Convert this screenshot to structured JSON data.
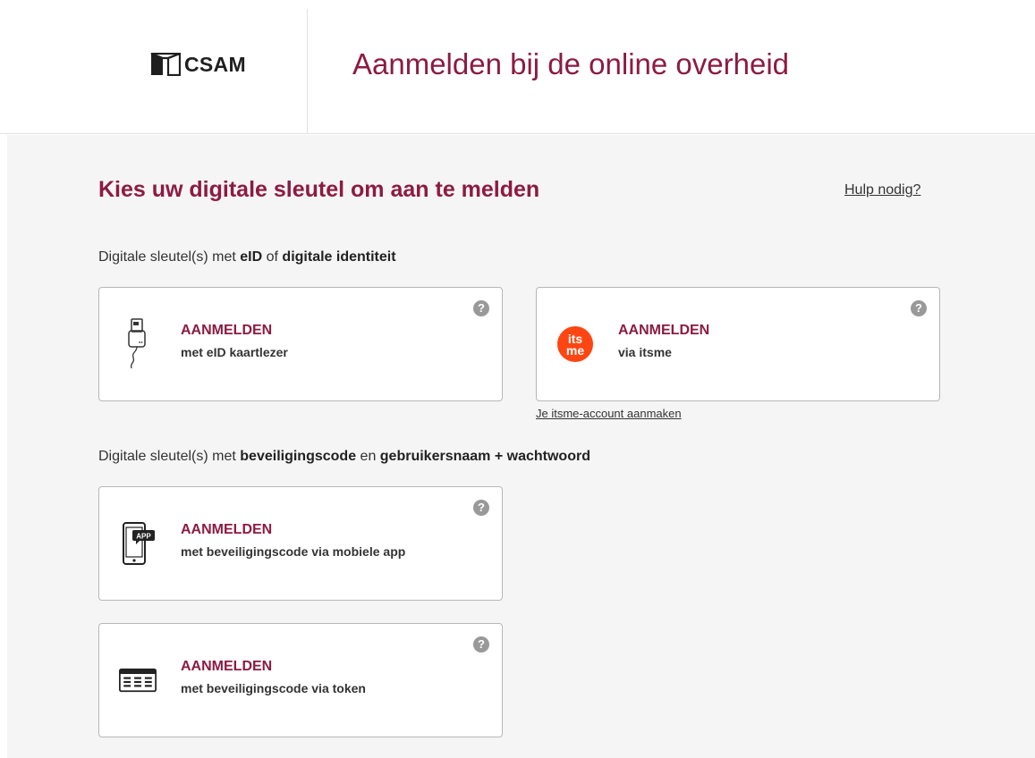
{
  "header": {
    "logo_text": "CSAM",
    "title": "Aanmelden bij de online overheid"
  },
  "main": {
    "title": "Kies uw digitale sleutel om aan te melden",
    "help_link": "Hulp nodig?",
    "section1": {
      "prefix": "Digitale sleutel(s) met ",
      "bold1": "eID",
      "middle": " of ",
      "bold2": "digitale identiteit"
    },
    "section2": {
      "prefix": "Digitale sleutel(s) met ",
      "bold1": "beveiligingscode",
      "middle": " en ",
      "bold2": "gebruikersnaam + wachtwoord"
    },
    "cards": [
      {
        "icon": "card-reader-icon",
        "title": "AANMELDEN",
        "subtitle": "met eID kaartlezer",
        "help": "?"
      },
      {
        "icon": "itsme-icon",
        "title": "AANMELDEN",
        "subtitle": "via itsme",
        "help": "?"
      },
      {
        "icon": "mobile-app-icon",
        "title": "AANMELDEN",
        "subtitle": "met beveiligingscode via mobiele app",
        "help": "?"
      },
      {
        "icon": "token-icon",
        "title": "AANMELDEN",
        "subtitle": "met beveiligingscode via token",
        "help": "?"
      }
    ],
    "itsme_create_link": "Je itsme-account aanmaken",
    "itsme_logo_text_top": "its",
    "itsme_logo_text_bottom": "me",
    "app_badge_text": "APP"
  },
  "colors": {
    "brand": "#8c1b42",
    "itsme": "#ff4612",
    "background": "#f5f5f5",
    "card_border": "#b7b7b7"
  }
}
